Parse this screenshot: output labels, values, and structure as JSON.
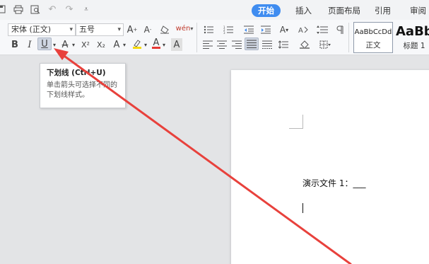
{
  "quick_access": {
    "icons": [
      "save-icon",
      "print-icon",
      "print-preview-icon",
      "undo-icon",
      "redo-icon",
      "customize-toolbar-icon"
    ]
  },
  "tabs": [
    {
      "label": "开始",
      "active": true
    },
    {
      "label": "插入",
      "active": false
    },
    {
      "label": "页面布局",
      "active": false
    },
    {
      "label": "引用",
      "active": false
    },
    {
      "label": "审阅",
      "active": false
    }
  ],
  "font": {
    "name": "宋体 (正文)",
    "size": "五号",
    "grow_label": "A",
    "shrink_label": "A",
    "phonetic_label": "wén"
  },
  "format": {
    "bold": "B",
    "italic": "I",
    "underline": "U",
    "strike": "A",
    "superscript": "X²",
    "subscript": "X₂",
    "effects": "A",
    "char_shade": "A"
  },
  "styles": [
    {
      "sample": "AaBbCcDd",
      "label": "正文"
    },
    {
      "sample": "AaBb",
      "label": "标题 1"
    }
  ],
  "tooltip": {
    "title": "下划线 (Ctrl+U)",
    "description": "单击箭头可选择不同的下划线样式。"
  },
  "document": {
    "text": "演示文件 1：___"
  },
  "colors": {
    "accent": "#3f8cf0",
    "annotation_arrow": "#e8413c",
    "font_color": "#e53935",
    "highlight": "#f5d90a"
  }
}
